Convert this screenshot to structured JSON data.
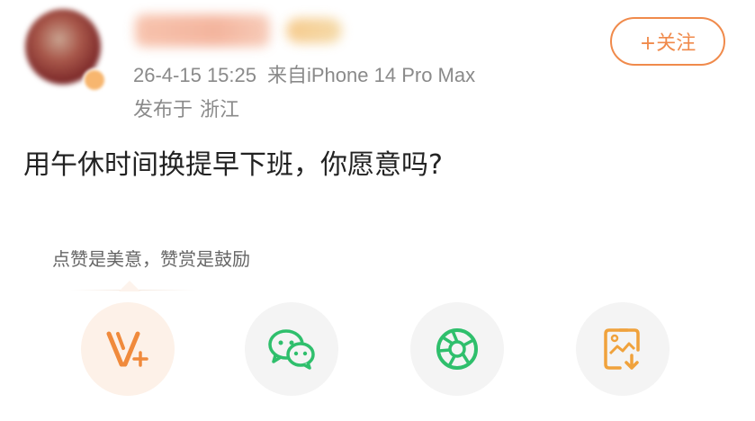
{
  "post": {
    "timestamp": "26-4-15 15:25",
    "source": "来自iPhone 14 Pro Max",
    "location_label": "发布于",
    "location": "浙江",
    "text": "用午休时间换提早下班，你愿意吗?"
  },
  "follow_button": {
    "label": "+关注"
  },
  "reward": {
    "hint": "点赞是美意，赞赏是鼓励",
    "options": [
      {
        "icon": "v-plus-icon",
        "color": "#f08a3c"
      },
      {
        "icon": "wechat-icon",
        "color": "#2fbf6c"
      },
      {
        "icon": "moments-icon",
        "color": "#2fbf6c"
      },
      {
        "icon": "save-image-icon",
        "color": "#f0a23c"
      }
    ]
  }
}
